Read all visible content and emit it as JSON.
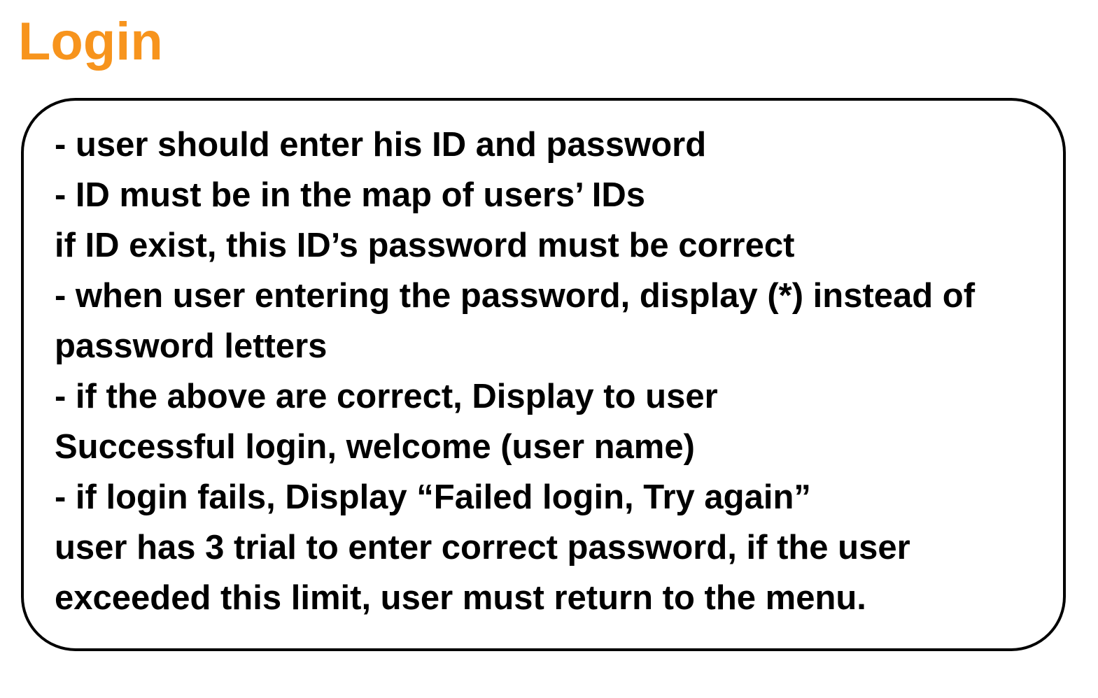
{
  "page": {
    "title": "Login",
    "title_color": "#f7941d",
    "text_color": "#000000"
  },
  "rules": {
    "lines": [
      "- user should enter his ID and password",
      "- ID must be in the map of users’ IDs",
      "if ID exist, this ID’s password must be correct",
      "- when user entering the password, display (*) instead of",
      "password letters",
      "- if the above are correct, Display to user",
      "Successful login, welcome (user name)",
      "- if login fails, Display “Failed login, Try again”",
      "user has 3 trial to enter correct password, if the user",
      "exceeded this limit, user must return to the menu."
    ]
  }
}
